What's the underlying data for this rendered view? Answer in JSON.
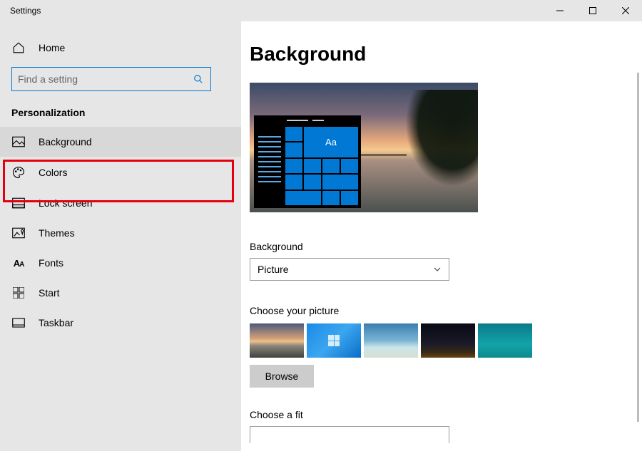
{
  "window": {
    "title": "Settings"
  },
  "sidebar": {
    "home_label": "Home",
    "search_placeholder": "Find a setting",
    "category": "Personalization",
    "items": [
      {
        "label": "Background",
        "icon": "picture-icon",
        "selected": true
      },
      {
        "label": "Colors",
        "icon": "palette-icon"
      },
      {
        "label": "Lock screen",
        "icon": "lockscreen-icon"
      },
      {
        "label": "Themes",
        "icon": "themes-icon"
      },
      {
        "label": "Fonts",
        "icon": "fonts-icon"
      },
      {
        "label": "Start",
        "icon": "start-icon"
      },
      {
        "label": "Taskbar",
        "icon": "taskbar-icon"
      }
    ]
  },
  "main": {
    "title": "Background",
    "preview_sample_text": "Aa",
    "background_label": "Background",
    "background_value": "Picture",
    "choose_picture_label": "Choose your picture",
    "browse_label": "Browse",
    "choose_fit_label": "Choose a fit"
  }
}
